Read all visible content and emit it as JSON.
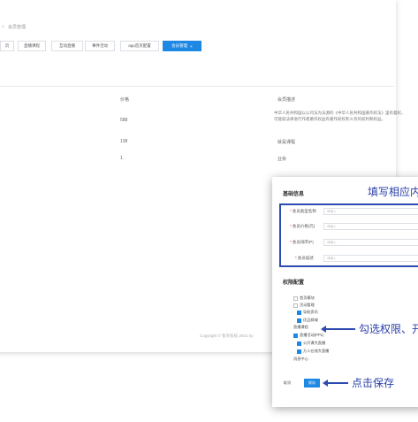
{
  "breadcrumb": {
    "home_icon": "home-icon",
    "text": "会员管理"
  },
  "tabs": [
    {
      "label": "页"
    },
    {
      "label": "直播课程"
    },
    {
      "label": "互动直播"
    },
    {
      "label": "事件活动"
    },
    {
      "label": "app首页配置"
    },
    {
      "label": "会员管理",
      "close": "×"
    }
  ],
  "table": {
    "headers": {
      "price": "价格",
      "desc": "会员描述"
    },
    "rows": [
      {
        "price": "588",
        "desc": "中华人民共和国以公司法在出现的《中华人民共和国著作权法》著作权..."
      },
      {
        "price": "138",
        "desc": "就是课程"
      },
      {
        "price": "1",
        "desc": "业余"
      }
    ],
    "desc_full": "中华人民共和国以公司法为法源的《中华人民共和国著作权法》里有着权，可能就法律进行作者著作权益有著作权权利义务的权利和权益。"
  },
  "copyright": "Copyright © 智天科技 2021 by",
  "modal": {
    "basic_title": "基础信息",
    "basic_annotation": "填写相应内",
    "fields": [
      {
        "label": "会员类型名称",
        "placeholder": "请输入"
      },
      {
        "label": "会员价格(元)",
        "placeholder": "请输入"
      },
      {
        "label": "会员排序(P)",
        "placeholder": "请输入"
      },
      {
        "label": "会员描述",
        "placeholder": "请输入"
      }
    ],
    "perm_title": "权限配置",
    "perms": [
      {
        "label": "首页模块",
        "checked": false
      },
      {
        "label": "活动管理",
        "checked": false
      },
      {
        "label": "导航资讯",
        "checked": true
      },
      {
        "label": "优品商城",
        "checked": true
      },
      {
        "label": "直播课程",
        "checked": false
      },
      {
        "label": "直播活动(PPL)",
        "checked": true
      },
      {
        "label": "公开课大直播",
        "checked": true
      },
      {
        "label": "万人在线大直播",
        "checked": true
      },
      {
        "label": "消息中心",
        "checked": false
      }
    ],
    "perm_annotation": "勾选权限、开",
    "cancel_label": "取消",
    "save_label": "保存",
    "save_annotation": "点击保存"
  },
  "colors": {
    "accent": "#1e88e5",
    "annotation": "#2d4bb0"
  }
}
